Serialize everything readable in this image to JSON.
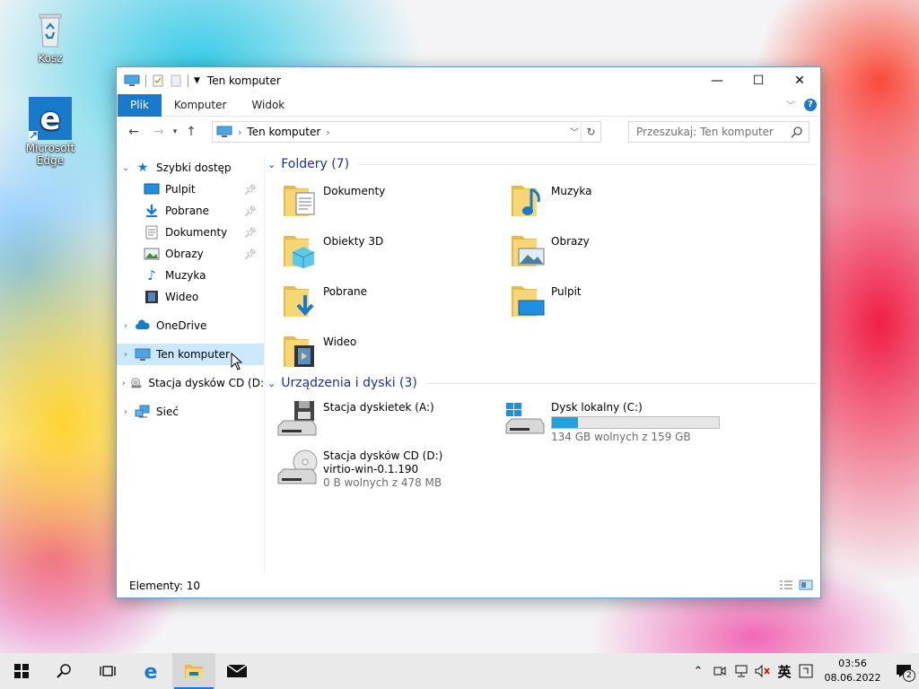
{
  "desktop": {
    "icons": [
      {
        "label": "Kosz",
        "icon": "recycle-bin-icon"
      },
      {
        "label": "Microsoft Edge",
        "icon": "edge-icon"
      }
    ]
  },
  "window": {
    "title": "Ten komputer",
    "controls": {
      "minimize": "—",
      "maximize": "☐",
      "close": "✕"
    },
    "ribbon_tabs": [
      {
        "label": "Plik",
        "active": true
      },
      {
        "label": "Komputer",
        "active": false
      },
      {
        "label": "Widok",
        "active": false
      }
    ],
    "address": {
      "location": "Ten komputer"
    },
    "search": {
      "placeholder": "Przeszukaj: Ten komputer"
    },
    "sidebar": {
      "quick_access": "Szybki dostęp",
      "pinned": [
        {
          "label": "Pulpit",
          "pinned": true
        },
        {
          "label": "Pobrane",
          "pinned": true
        },
        {
          "label": "Dokumenty",
          "pinned": true
        },
        {
          "label": "Obrazy",
          "pinned": true
        },
        {
          "label": "Muzyka",
          "pinned": false
        },
        {
          "label": "Wideo",
          "pinned": false
        }
      ],
      "onedrive": "OneDrive",
      "this_pc": "Ten komputer",
      "cd_drive": "Stacja dysków CD (D:",
      "network": "Sieć"
    },
    "groups": {
      "folders_header": "Foldery (7)",
      "folders": [
        {
          "name": "Dokumenty",
          "overlay": "document"
        },
        {
          "name": "Muzyka",
          "overlay": "music"
        },
        {
          "name": "Obiekty 3D",
          "overlay": "cube"
        },
        {
          "name": "Obrazy",
          "overlay": "picture"
        },
        {
          "name": "Pobrane",
          "overlay": "download"
        },
        {
          "name": "Pulpit",
          "overlay": "desktop"
        },
        {
          "name": "Wideo",
          "overlay": "video"
        }
      ],
      "devices_header": "Urządzenia i dyski (3)",
      "drives": {
        "floppy": {
          "name": "Stacja dyskietek (A:)"
        },
        "local": {
          "name": "Dysk lokalny (C:)",
          "free": "134 GB wolnych z 159 GB",
          "used_fraction": 0.157
        },
        "cd": {
          "name": "Stacja dysków CD (D:)",
          "label": "virtio-win-0.1.190",
          "free": "0 B wolnych z 478 MB"
        }
      }
    },
    "status": "Elementy: 10"
  },
  "taskbar": {
    "clock_time": "03:56",
    "clock_date": "08.06.2022",
    "ime": "英",
    "notification_count": "2"
  },
  "colors": {
    "accent": "#1979ca",
    "header_text": "#1e3287",
    "bar_fill": "#26a0da",
    "selection": "#cce8ff"
  }
}
